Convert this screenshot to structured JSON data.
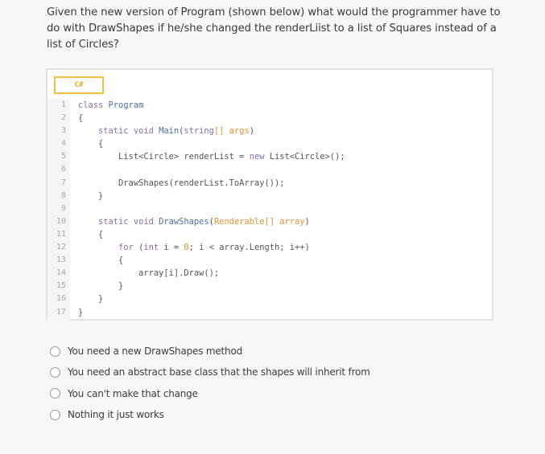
{
  "question": {
    "text": "Given the new version of Program (shown below) what would the programmer have to do with DrawShapes if he/she changed the renderLiist to a list of Squares instead of a list of Circles?"
  },
  "code_block": {
    "language_tab": "C#",
    "lines": [
      {
        "n": "1",
        "tokens": [
          [
            "kw",
            "class "
          ],
          [
            "ty",
            "Program"
          ]
        ]
      },
      {
        "n": "2",
        "tokens": [
          [
            "",
            "{"
          ]
        ]
      },
      {
        "n": "3",
        "tokens": [
          [
            "",
            "    "
          ],
          [
            "kw",
            "static void "
          ],
          [
            "fn",
            "Main"
          ],
          [
            "",
            "("
          ],
          [
            "kw",
            "string"
          ],
          [
            "pr",
            "[] args"
          ],
          [
            "",
            ")"
          ]
        ]
      },
      {
        "n": "4",
        "tokens": [
          [
            "",
            "    {"
          ]
        ]
      },
      {
        "n": "5",
        "tokens": [
          [
            "",
            "        List<Circle> renderList = "
          ],
          [
            "kw",
            "new"
          ],
          [
            "",
            " List<Circle>();"
          ]
        ]
      },
      {
        "n": "6",
        "tokens": [
          [
            "",
            ""
          ]
        ]
      },
      {
        "n": "7",
        "tokens": [
          [
            "",
            "        DrawShapes(renderList.ToArray());"
          ]
        ]
      },
      {
        "n": "8",
        "tokens": [
          [
            "",
            "    }"
          ]
        ]
      },
      {
        "n": "9",
        "tokens": [
          [
            "",
            ""
          ]
        ]
      },
      {
        "n": "10",
        "tokens": [
          [
            "",
            "    "
          ],
          [
            "kw",
            "static void "
          ],
          [
            "fn",
            "DrawShapes"
          ],
          [
            "",
            "("
          ],
          [
            "pr",
            "Renderable[] array"
          ],
          [
            "",
            ")"
          ]
        ]
      },
      {
        "n": "11",
        "tokens": [
          [
            "",
            "    {"
          ]
        ]
      },
      {
        "n": "12",
        "tokens": [
          [
            "",
            "        "
          ],
          [
            "kw",
            "for"
          ],
          [
            "",
            " ("
          ],
          [
            "kw",
            "int"
          ],
          [
            "",
            " i = "
          ],
          [
            "nu",
            "0"
          ],
          [
            "",
            "; i < array.Length; i++)"
          ]
        ]
      },
      {
        "n": "13",
        "tokens": [
          [
            "",
            "        {"
          ]
        ]
      },
      {
        "n": "14",
        "tokens": [
          [
            "",
            "            array[i].Draw();"
          ]
        ]
      },
      {
        "n": "15",
        "tokens": [
          [
            "",
            "        }"
          ]
        ]
      },
      {
        "n": "16",
        "tokens": [
          [
            "",
            "    }"
          ]
        ]
      },
      {
        "n": "17",
        "tokens": [
          [
            "",
            "}"
          ]
        ]
      }
    ]
  },
  "answers": {
    "options": [
      {
        "label": "You need a new DrawShapes method",
        "selected": false
      },
      {
        "label": "You need an abstract base class that the shapes will inherit from",
        "selected": false
      },
      {
        "label": "You can't make that change",
        "selected": false
      },
      {
        "label": "Nothing it just works",
        "selected": false
      }
    ]
  },
  "colors": {
    "accent_tab": "#f0c040",
    "keyword": "#8a6fa6",
    "type": "#4d6fa3",
    "param": "#e8912d"
  }
}
